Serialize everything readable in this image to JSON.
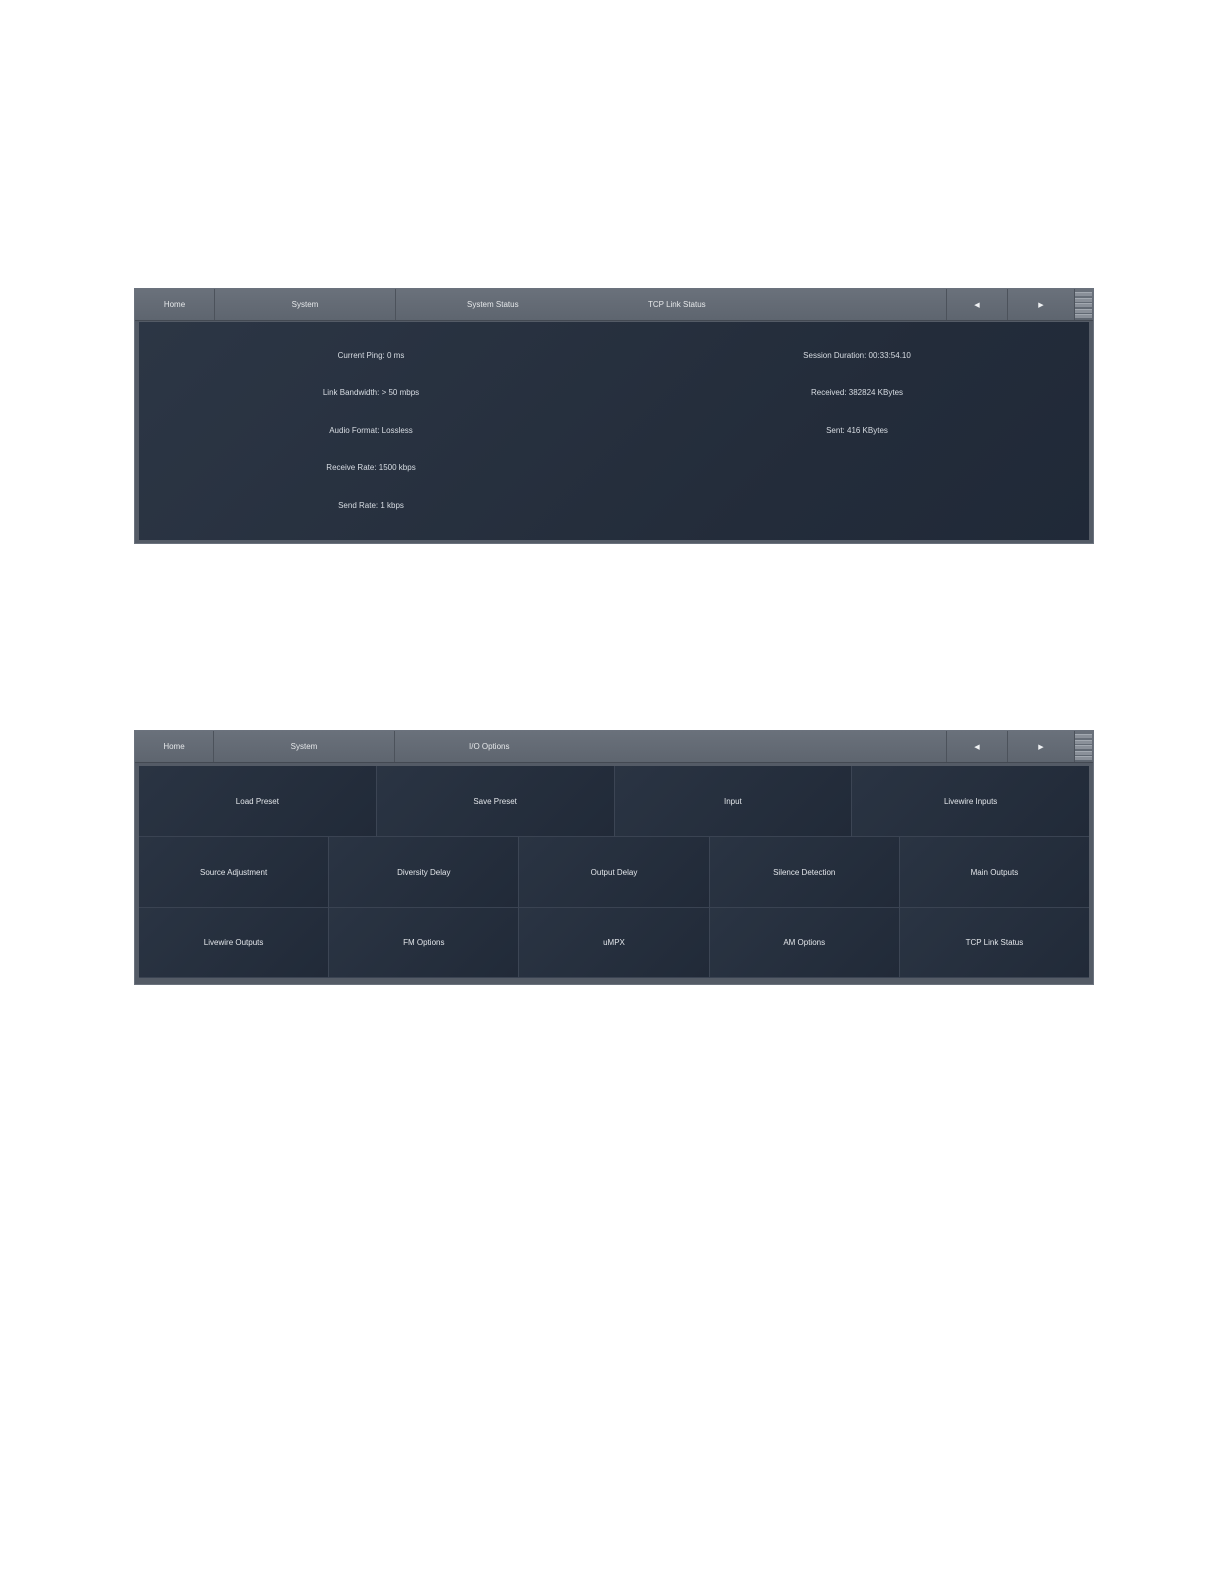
{
  "panel1": {
    "nav": {
      "home": "Home",
      "system": "System",
      "crumb1": "System Status",
      "crumb2": "TCP Link Status",
      "prev": "◀",
      "next": "▶"
    },
    "left_stats": [
      "Current Ping: 0 ms",
      "Link Bandwidth: > 50 mbps",
      "Audio Format: Lossless",
      "Receive Rate: 1500 kbps",
      "Send Rate: 1 kbps"
    ],
    "right_stats": [
      "Session Duration: 00:33:54.10",
      "Received: 382824 KBytes",
      "Sent: 416 KBytes"
    ]
  },
  "panel2": {
    "nav": {
      "home": "Home",
      "system": "System",
      "crumb1": "I/O Options",
      "prev": "◀",
      "next": "▶"
    },
    "row1": [
      "Load Preset",
      "Save Preset",
      "Input",
      "Livewire Inputs"
    ],
    "row2": [
      "Source Adjustment",
      "Diversity Delay",
      "Output Delay",
      "Silence Detection",
      "Main Outputs"
    ],
    "row3": [
      "Livewire Outputs",
      "FM Options",
      "uMPX",
      "AM Options",
      "TCP Link Status"
    ]
  }
}
